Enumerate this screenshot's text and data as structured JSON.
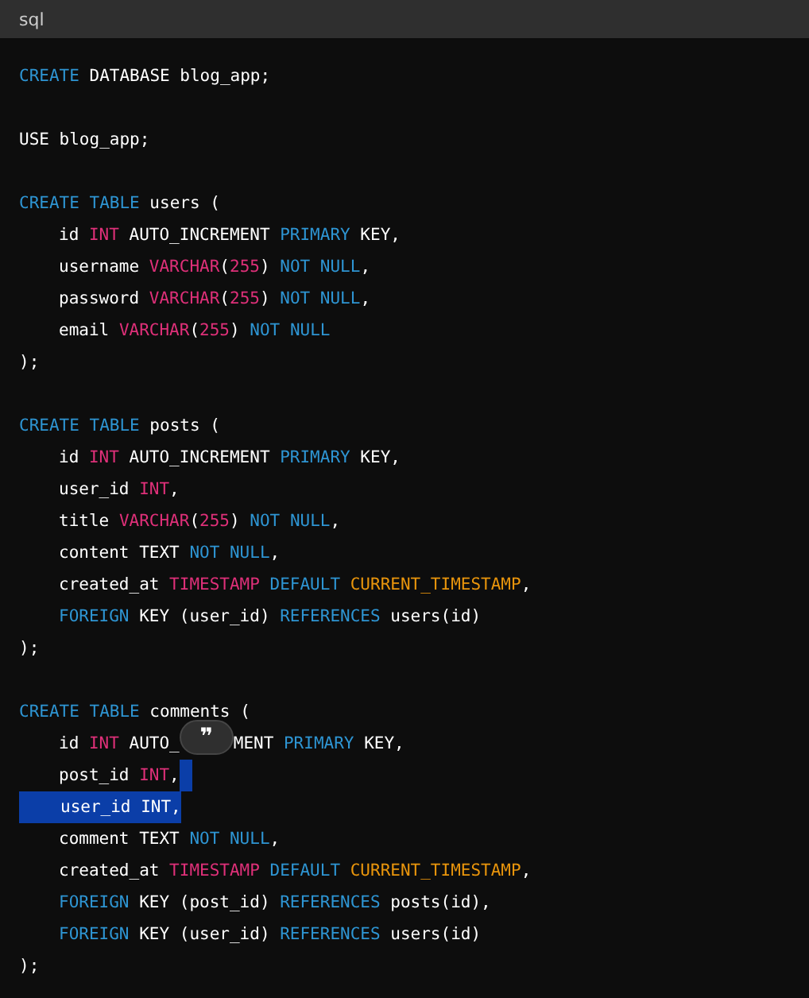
{
  "header": {
    "language": "sql"
  },
  "blocks": [
    [
      {
        "indented": false,
        "selected": false,
        "tail_selected": false,
        "tokens": [
          {
            "kind": "keyword",
            "text": "CREATE"
          },
          {
            "kind": "plain",
            "text": " DATABASE blog_app;"
          }
        ]
      }
    ],
    [
      {
        "indented": false,
        "selected": false,
        "tail_selected": false,
        "tokens": [
          {
            "kind": "plain",
            "text": "USE blog_app;"
          }
        ]
      }
    ],
    [
      {
        "indented": false,
        "selected": false,
        "tail_selected": false,
        "tokens": [
          {
            "kind": "keyword",
            "text": "CREATE TABLE"
          },
          {
            "kind": "plain",
            "text": " users ("
          }
        ]
      },
      {
        "indented": true,
        "selected": false,
        "tail_selected": false,
        "tokens": [
          {
            "kind": "plain",
            "text": "id "
          },
          {
            "kind": "type",
            "text": "INT"
          },
          {
            "kind": "plain",
            "text": " AUTO_INCREMENT "
          },
          {
            "kind": "keyword",
            "text": "PRIMARY"
          },
          {
            "kind": "plain",
            "text": " KEY,"
          }
        ]
      },
      {
        "indented": true,
        "selected": false,
        "tail_selected": false,
        "tokens": [
          {
            "kind": "plain",
            "text": "username "
          },
          {
            "kind": "type",
            "text": "VARCHAR"
          },
          {
            "kind": "plain",
            "text": "("
          },
          {
            "kind": "number",
            "text": "255"
          },
          {
            "kind": "plain",
            "text": ") "
          },
          {
            "kind": "keyword",
            "text": "NOT NULL"
          },
          {
            "kind": "plain",
            "text": ","
          }
        ]
      },
      {
        "indented": true,
        "selected": false,
        "tail_selected": false,
        "tokens": [
          {
            "kind": "plain",
            "text": "password "
          },
          {
            "kind": "type",
            "text": "VARCHAR"
          },
          {
            "kind": "plain",
            "text": "("
          },
          {
            "kind": "number",
            "text": "255"
          },
          {
            "kind": "plain",
            "text": ") "
          },
          {
            "kind": "keyword",
            "text": "NOT NULL"
          },
          {
            "kind": "plain",
            "text": ","
          }
        ]
      },
      {
        "indented": true,
        "selected": false,
        "tail_selected": false,
        "tokens": [
          {
            "kind": "plain",
            "text": "email "
          },
          {
            "kind": "type",
            "text": "VARCHAR"
          },
          {
            "kind": "plain",
            "text": "("
          },
          {
            "kind": "number",
            "text": "255"
          },
          {
            "kind": "plain",
            "text": ") "
          },
          {
            "kind": "keyword",
            "text": "NOT NULL"
          }
        ]
      },
      {
        "indented": false,
        "selected": false,
        "tail_selected": false,
        "tokens": [
          {
            "kind": "plain",
            "text": ");"
          }
        ]
      }
    ],
    [
      {
        "indented": false,
        "selected": false,
        "tail_selected": false,
        "tokens": [
          {
            "kind": "keyword",
            "text": "CREATE TABLE"
          },
          {
            "kind": "plain",
            "text": " posts ("
          }
        ]
      },
      {
        "indented": true,
        "selected": false,
        "tail_selected": false,
        "tokens": [
          {
            "kind": "plain",
            "text": "id "
          },
          {
            "kind": "type",
            "text": "INT"
          },
          {
            "kind": "plain",
            "text": " AUTO_INCREMENT "
          },
          {
            "kind": "keyword",
            "text": "PRIMARY"
          },
          {
            "kind": "plain",
            "text": " KEY,"
          }
        ]
      },
      {
        "indented": true,
        "selected": false,
        "tail_selected": false,
        "tokens": [
          {
            "kind": "plain",
            "text": "user_id "
          },
          {
            "kind": "type",
            "text": "INT"
          },
          {
            "kind": "plain",
            "text": ","
          }
        ]
      },
      {
        "indented": true,
        "selected": false,
        "tail_selected": false,
        "tokens": [
          {
            "kind": "plain",
            "text": "title "
          },
          {
            "kind": "type",
            "text": "VARCHAR"
          },
          {
            "kind": "plain",
            "text": "("
          },
          {
            "kind": "number",
            "text": "255"
          },
          {
            "kind": "plain",
            "text": ") "
          },
          {
            "kind": "keyword",
            "text": "NOT NULL"
          },
          {
            "kind": "plain",
            "text": ","
          }
        ]
      },
      {
        "indented": true,
        "selected": false,
        "tail_selected": false,
        "tokens": [
          {
            "kind": "plain",
            "text": "content TEXT "
          },
          {
            "kind": "keyword",
            "text": "NOT NULL"
          },
          {
            "kind": "plain",
            "text": ","
          }
        ]
      },
      {
        "indented": true,
        "selected": false,
        "tail_selected": false,
        "tokens": [
          {
            "kind": "plain",
            "text": "created_at "
          },
          {
            "kind": "type",
            "text": "TIMESTAMP"
          },
          {
            "kind": "keyword",
            "text": " DEFAULT "
          },
          {
            "kind": "constant",
            "text": "CURRENT_TIMESTAMP"
          },
          {
            "kind": "plain",
            "text": ","
          }
        ]
      },
      {
        "indented": true,
        "selected": false,
        "tail_selected": false,
        "tokens": [
          {
            "kind": "keyword",
            "text": "FOREIGN"
          },
          {
            "kind": "plain",
            "text": " KEY (user_id) "
          },
          {
            "kind": "keyword",
            "text": "REFERENCES"
          },
          {
            "kind": "plain",
            "text": " users(id)"
          }
        ]
      },
      {
        "indented": false,
        "selected": false,
        "tail_selected": false,
        "tokens": [
          {
            "kind": "plain",
            "text": ");"
          }
        ]
      }
    ],
    [
      {
        "indented": false,
        "selected": false,
        "tail_selected": false,
        "tokens": [
          {
            "kind": "keyword",
            "text": "CREATE TABLE"
          },
          {
            "kind": "plain",
            "text": " comments ("
          }
        ]
      },
      {
        "indented": true,
        "selected": false,
        "tail_selected": false,
        "tokens": [
          {
            "kind": "plain",
            "text": "id "
          },
          {
            "kind": "type",
            "text": "INT"
          },
          {
            "kind": "plain",
            "text": " AUTO_"
          },
          {
            "kind": "quote_button",
            "text": "❞"
          },
          {
            "kind": "plain",
            "text": "MENT "
          },
          {
            "kind": "keyword",
            "text": "PRIMARY"
          },
          {
            "kind": "plain",
            "text": " KEY,"
          }
        ]
      },
      {
        "indented": true,
        "selected": false,
        "tail_selected": true,
        "tokens": [
          {
            "kind": "plain",
            "text": "post_id "
          },
          {
            "kind": "type",
            "text": "INT"
          },
          {
            "kind": "plain",
            "text": ","
          }
        ]
      },
      {
        "indented": true,
        "selected": true,
        "tail_selected": false,
        "tokens": [
          {
            "kind": "plain",
            "text": "user_id "
          },
          {
            "kind": "type",
            "text": "INT"
          },
          {
            "kind": "plain",
            "text": ","
          }
        ]
      },
      {
        "indented": true,
        "selected": false,
        "tail_selected": false,
        "tokens": [
          {
            "kind": "plain",
            "text": "comment TEXT "
          },
          {
            "kind": "keyword",
            "text": "NOT NULL"
          },
          {
            "kind": "plain",
            "text": ","
          }
        ]
      },
      {
        "indented": true,
        "selected": false,
        "tail_selected": false,
        "tokens": [
          {
            "kind": "plain",
            "text": "created_at "
          },
          {
            "kind": "type",
            "text": "TIMESTAMP"
          },
          {
            "kind": "keyword",
            "text": " DEFAULT "
          },
          {
            "kind": "constant",
            "text": "CURRENT_TIMESTAMP"
          },
          {
            "kind": "plain",
            "text": ","
          }
        ]
      },
      {
        "indented": true,
        "selected": false,
        "tail_selected": false,
        "tokens": [
          {
            "kind": "keyword",
            "text": "FOREIGN"
          },
          {
            "kind": "plain",
            "text": " KEY (post_id) "
          },
          {
            "kind": "keyword",
            "text": "REFERENCES"
          },
          {
            "kind": "plain",
            "text": " posts(id),"
          }
        ]
      },
      {
        "indented": true,
        "selected": false,
        "tail_selected": false,
        "tokens": [
          {
            "kind": "keyword",
            "text": "FOREIGN"
          },
          {
            "kind": "plain",
            "text": " KEY (user_id) "
          },
          {
            "kind": "keyword",
            "text": "REFERENCES"
          },
          {
            "kind": "plain",
            "text": " users(id)"
          }
        ]
      },
      {
        "indented": false,
        "selected": false,
        "tail_selected": false,
        "tokens": [
          {
            "kind": "plain",
            "text": ");"
          }
        ]
      }
    ]
  ]
}
